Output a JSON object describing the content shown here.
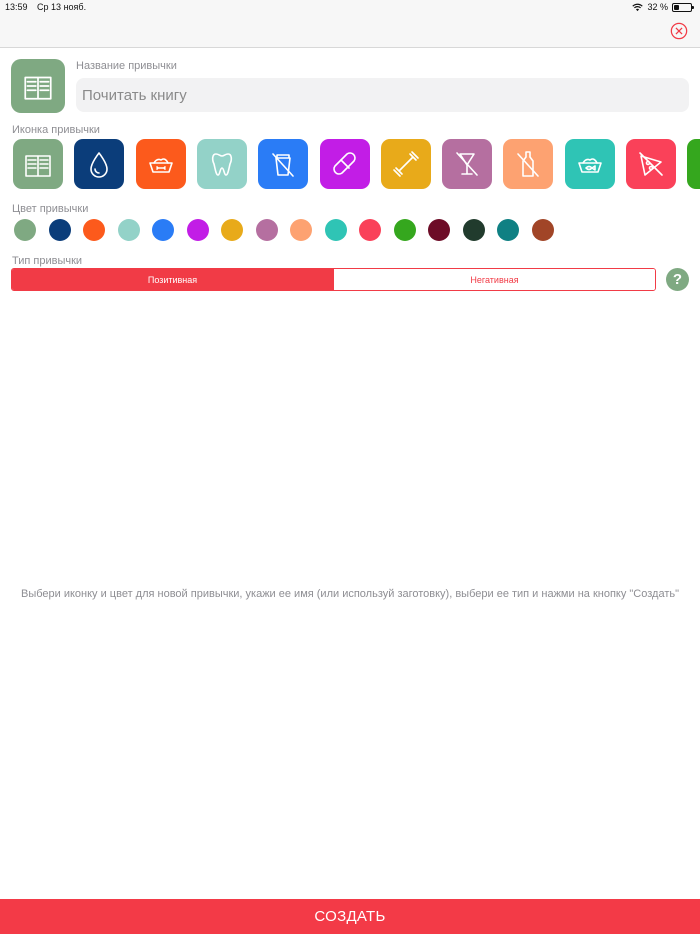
{
  "status_bar": {
    "time": "13:59",
    "date": "Ср 13 нояб.",
    "battery_text": "32 %",
    "battery_level": 0.32
  },
  "nav": {
    "close_icon": "close-circle-icon",
    "accent_color": "#f13b46"
  },
  "habit": {
    "preview_icon": "book-icon",
    "preview_color": "#7fa982",
    "name_label": "Название привычки",
    "name_value": "",
    "name_placeholder": "Почитать книгу"
  },
  "icon_section": {
    "label": "Иконка привычки",
    "icons": [
      {
        "name": "book-icon",
        "color": "#7fa982"
      },
      {
        "name": "water-drop-icon",
        "color": "#0b3d7a"
      },
      {
        "name": "pet-bowl-icon",
        "color": "#fc5a1c"
      },
      {
        "name": "tooth-icon",
        "color": "#93d2c8"
      },
      {
        "name": "no-coffee-icon",
        "color": "#2a7cf6"
      },
      {
        "name": "pill-icon",
        "color": "#c21de6"
      },
      {
        "name": "dumbbell-icon",
        "color": "#e8aa1a"
      },
      {
        "name": "no-alcohol-icon",
        "color": "#b56fa0"
      },
      {
        "name": "no-bottle-icon",
        "color": "#fda271"
      },
      {
        "name": "fish-bowl-icon",
        "color": "#2fc4b5"
      },
      {
        "name": "no-pizza-icon",
        "color": "#fa4159"
      },
      {
        "name": "partial-icon",
        "color": "#35a71e"
      }
    ]
  },
  "color_section": {
    "label": "Цвет привычки",
    "colors": [
      "#7fa982",
      "#0b3d7a",
      "#fc5a1c",
      "#93d2c8",
      "#2a7cf6",
      "#c21de6",
      "#e8aa1a",
      "#b56fa0",
      "#fda271",
      "#2fc4b5",
      "#fa4159",
      "#35a71e",
      "#6d0c27",
      "#213b2d",
      "#0f8083",
      "#a14527"
    ]
  },
  "type_section": {
    "label": "Тип привычки",
    "positive": "Позитивная",
    "negative": "Негативная",
    "selected": "Позитивная",
    "help": "?"
  },
  "hint_text": "Выбери иконку и цвет для новой привычки, укажи ее имя (или используй заготовку), выбери ее тип и нажми на кнопку \"Создать\"",
  "create_button": "СОЗДАТЬ"
}
